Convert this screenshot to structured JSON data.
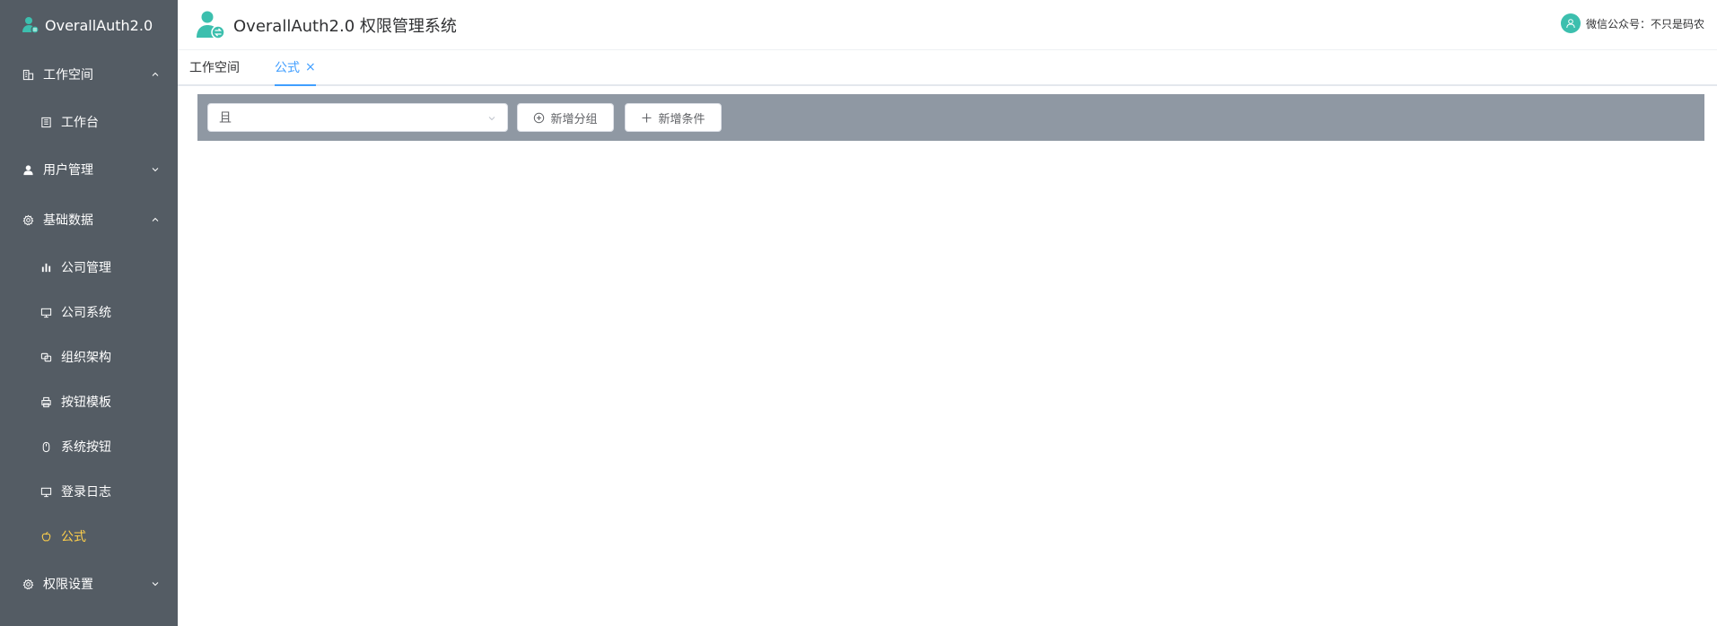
{
  "sidebar": {
    "brand": "OverallAuth2.0",
    "items": [
      {
        "label": "工作空间",
        "icon": "building-icon",
        "level": "group",
        "expanded": true
      },
      {
        "label": "工作台",
        "icon": "office-icon",
        "level": "sub"
      },
      {
        "label": "用户管理",
        "icon": "user-icon",
        "level": "group",
        "expanded": false
      },
      {
        "label": "基础数据",
        "icon": "gear-icon",
        "level": "group",
        "expanded": true
      },
      {
        "label": "公司管理",
        "icon": "bar-chart-icon",
        "level": "sub"
      },
      {
        "label": "公司系统",
        "icon": "monitor-icon",
        "level": "sub"
      },
      {
        "label": "组织架构",
        "icon": "copy-icon",
        "level": "sub"
      },
      {
        "label": "按钮模板",
        "icon": "printer-icon",
        "level": "sub"
      },
      {
        "label": "系统按钮",
        "icon": "mouse-icon",
        "level": "sub"
      },
      {
        "label": "登录日志",
        "icon": "monitor-icon",
        "level": "sub"
      },
      {
        "label": "公式",
        "icon": "apple-icon",
        "level": "sub",
        "active": true
      },
      {
        "label": "权限设置",
        "icon": "gear-icon",
        "level": "group",
        "expanded": false
      }
    ]
  },
  "header": {
    "title": "OverallAuth2.0 权限管理系统",
    "user_text": "微信公众号：不只是码农"
  },
  "tabs": [
    {
      "label": "工作空间"
    },
    {
      "label": "公式",
      "active": true,
      "close": "×"
    }
  ],
  "toolbar": {
    "select_value": "且",
    "add_group_label": "新增分组",
    "add_condition_label": "新增条件"
  },
  "colors": {
    "sidebar_bg": "#545c64",
    "active_menu": "#ffd04b",
    "accent": "#409eff",
    "brand": "#3cbfae",
    "toolbar_bg": "#8f98a3"
  }
}
